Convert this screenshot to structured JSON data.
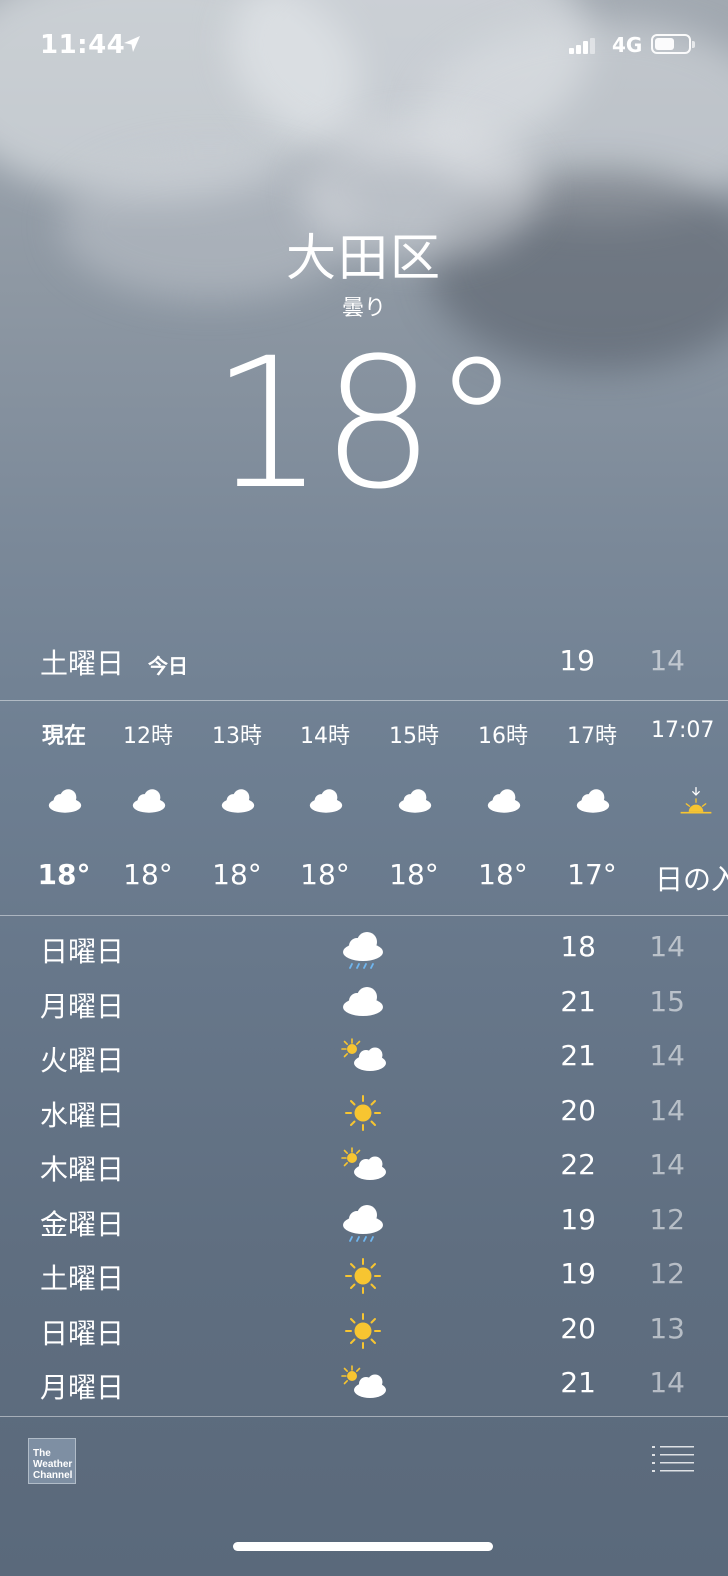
{
  "status_bar": {
    "time": "11:44",
    "network": "4G",
    "battery_level": 0.54
  },
  "location": {
    "city": "大田区",
    "condition": "曇り",
    "temperature": "18°"
  },
  "today": {
    "day": "土曜日",
    "badge": "今日",
    "high": "19",
    "low": "14"
  },
  "hourly": [
    {
      "label": "現在",
      "icon": "cloud-icon",
      "temp": "18°",
      "bold": true
    },
    {
      "label": "12時",
      "icon": "cloud-icon",
      "temp": "18°"
    },
    {
      "label": "13時",
      "icon": "cloud-icon",
      "temp": "18°"
    },
    {
      "label": "14時",
      "icon": "cloud-icon",
      "temp": "18°"
    },
    {
      "label": "15時",
      "icon": "cloud-icon",
      "temp": "18°"
    },
    {
      "label": "16時",
      "icon": "cloud-icon",
      "temp": "18°"
    },
    {
      "label": "17時",
      "icon": "cloud-icon",
      "temp": "17°"
    },
    {
      "label": "17:07",
      "icon": "sunset-icon",
      "temp": "日の入"
    }
  ],
  "daily": [
    {
      "day": "日曜日",
      "icon": "rain-cloud-icon",
      "high": "18",
      "low": "14"
    },
    {
      "day": "月曜日",
      "icon": "cloud-icon",
      "high": "21",
      "low": "15"
    },
    {
      "day": "火曜日",
      "icon": "partly-cloudy-icon",
      "high": "21",
      "low": "14"
    },
    {
      "day": "水曜日",
      "icon": "sun-icon",
      "high": "20",
      "low": "14"
    },
    {
      "day": "木曜日",
      "icon": "partly-cloudy-icon",
      "high": "22",
      "low": "14"
    },
    {
      "day": "金曜日",
      "icon": "rain-cloud-icon",
      "high": "19",
      "low": "12"
    },
    {
      "day": "土曜日",
      "icon": "sun-icon",
      "high": "19",
      "low": "12"
    },
    {
      "day": "日曜日",
      "icon": "sun-icon",
      "high": "20",
      "low": "13"
    },
    {
      "day": "月曜日",
      "icon": "partly-cloudy-icon",
      "high": "21",
      "low": "14"
    }
  ],
  "footer": {
    "brand_line1": "The",
    "brand_line2": "Weather",
    "brand_line3": "Channel"
  },
  "colors": {
    "sun": "#f7c531",
    "rain": "#6fb6ef",
    "cloud": "#ffffff"
  }
}
